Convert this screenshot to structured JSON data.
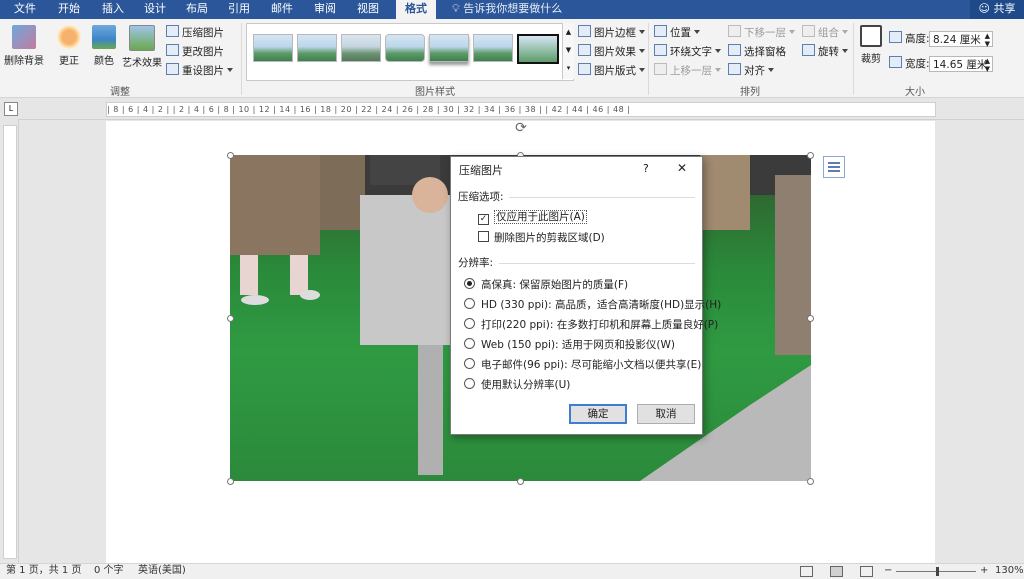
{
  "tabs": [
    "文件",
    "开始",
    "插入",
    "设计",
    "布局",
    "引用",
    "邮件",
    "审阅",
    "视图",
    "格式"
  ],
  "tell_me": "告诉我你想要做什么",
  "share_label": "共享",
  "ribbon": {
    "adjust": {
      "remove_bg": "删除背景",
      "corrections": "更正",
      "color": "颜色",
      "artistic": "艺术效果",
      "compress": "压缩图片",
      "change": "更改图片",
      "reset": "重设图片",
      "group_label": "调整"
    },
    "styles": {
      "border": "图片边框",
      "effects": "图片效果",
      "layout": "图片版式",
      "group_label": "图片样式"
    },
    "arrange": {
      "position": "位置",
      "wrap": "环绕文字",
      "bring_forward": "上移一层",
      "send_backward": "下移一层",
      "selection_pane": "选择窗格",
      "align": "对齐",
      "group": "组合",
      "rotate": "旋转",
      "group_label": "排列"
    },
    "size": {
      "crop": "裁剪",
      "height_label": "高度:",
      "height_value": "8.24 厘米",
      "width_label": "宽度:",
      "width_value": "14.65 厘米",
      "group_label": "大小"
    }
  },
  "ruler_text": "| 8 | 6 | 4 | 2 |   | 2 | 4 | 6 | 8 | 10 | 12 | 14 | 16 | 18 | 20 | 22 | 24 | 26 | 28 | 30 | 32 | 34 | 36 | 38 |   | 42 | 44 | 46 | 48 |",
  "dialog": {
    "title": "压缩图片",
    "help": "?",
    "close": "✕",
    "compress_options_label": "压缩选项:",
    "only_this_picture": "仅应用于此图片(A)",
    "only_this_checked": true,
    "delete_cropped": "删除图片的剪裁区域(D)",
    "delete_cropped_checked": false,
    "resolution_label": "分辨率:",
    "options": [
      {
        "label": "高保真: 保留原始图片的质量(F)",
        "selected": true
      },
      {
        "label": "HD (330 ppi): 高品质，适合高清晰度(HD)显示(H)",
        "selected": false
      },
      {
        "label": "打印(220 ppi): 在多数打印机和屏幕上质量良好(P)",
        "selected": false
      },
      {
        "label": "Web (150 ppi): 适用于网页和投影仪(W)",
        "selected": false
      },
      {
        "label": "电子邮件(96 ppi): 尽可能缩小文档以便共享(E)",
        "selected": false
      },
      {
        "label": "使用默认分辨率(U)",
        "selected": false
      }
    ],
    "ok": "确定",
    "cancel": "取消"
  },
  "status": {
    "page": "第 1 页，共 1 页",
    "words": "0 个字",
    "language": "英语(美国)",
    "zoom": "130%"
  },
  "colors": {
    "accent": "#2b579a",
    "ribbon_bg": "#f3f3f3",
    "photo_green": "#2f9a42"
  }
}
